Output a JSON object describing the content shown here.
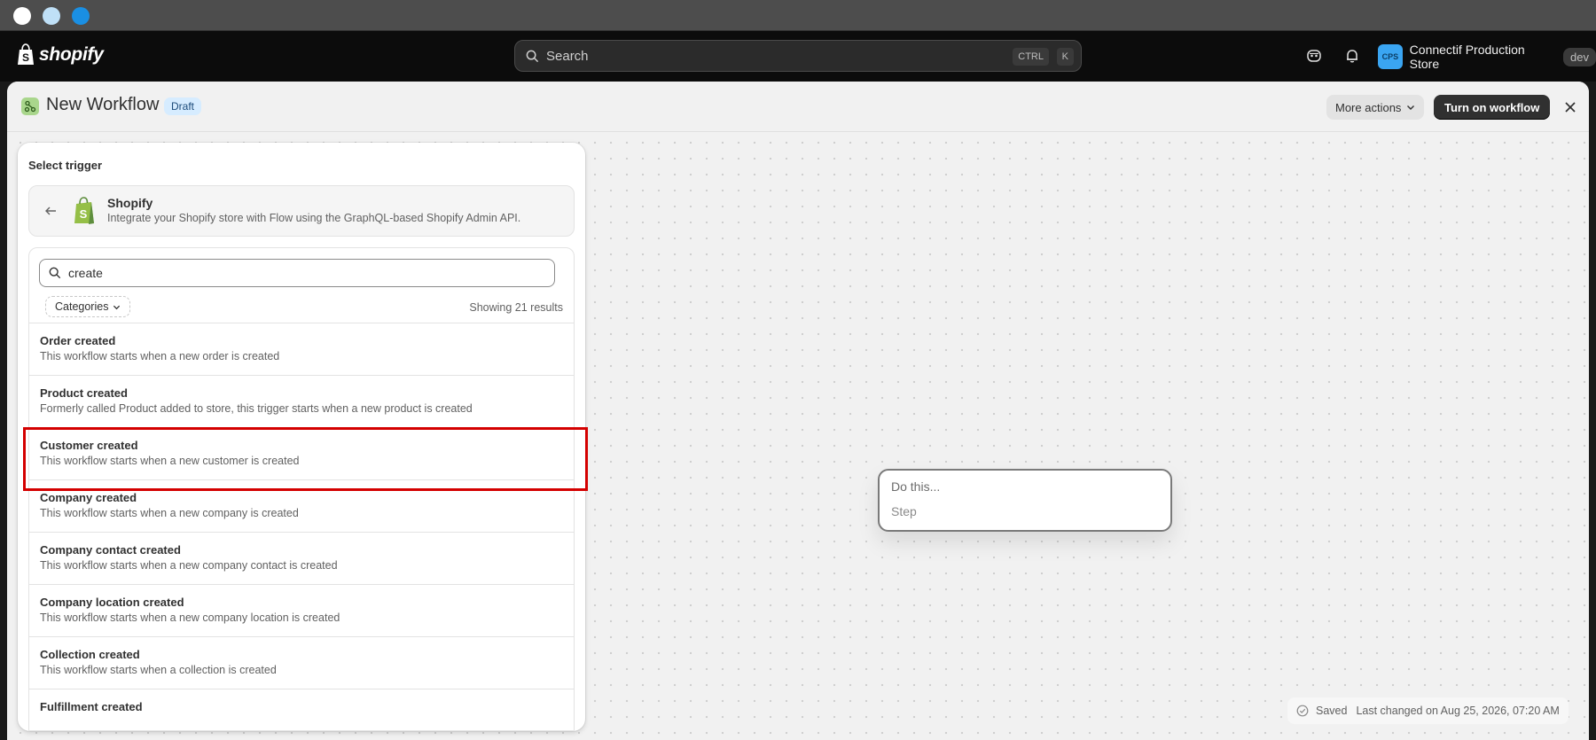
{
  "window": {
    "dots": [
      "close",
      "minimize",
      "maximize"
    ]
  },
  "topbar": {
    "brand": "shopify",
    "search_label": "Search",
    "shortcut_ctrl": "CTRL",
    "shortcut_k": "K",
    "store_avatar": "CPS",
    "store_name": "Connectif Production Store",
    "store_badge": "dev"
  },
  "header": {
    "title": "New Workflow",
    "status_badge": "Draft",
    "more_actions_label": "More actions",
    "turn_on_label": "Turn on workflow"
  },
  "trigger_panel": {
    "title": "Select trigger",
    "app_name": "Shopify",
    "app_description": "Integrate your Shopify store with Flow using the GraphQL-based Shopify Admin API.",
    "search_value": "create",
    "categories_label": "Categories",
    "results_text": "Showing 21 results",
    "selected_index": 2,
    "items": [
      {
        "title": "Order created",
        "description": "This workflow starts when a new order is created"
      },
      {
        "title": "Product created",
        "description": "Formerly called Product added to store, this trigger starts when a new product is created"
      },
      {
        "title": "Customer created",
        "description": "This workflow starts when a new customer is created"
      },
      {
        "title": "Company created",
        "description": "This workflow starts when a new company is created"
      },
      {
        "title": "Company contact created",
        "description": "This workflow starts when a new company contact is created"
      },
      {
        "title": "Company location created",
        "description": "This workflow starts when a new company location is created"
      },
      {
        "title": "Collection created",
        "description": "This workflow starts when a collection is created"
      },
      {
        "title": "Fulfillment created",
        "description": ""
      }
    ]
  },
  "canvas": {
    "node_heading": "Do this...",
    "node_step": "Step"
  },
  "footer": {
    "saved_label": "Saved",
    "last_changed": "Last changed on Aug 25, 2026, 07:20 AM"
  },
  "colors": {
    "topbar_bg": "#0c0c0c",
    "primary_button": "#303030",
    "draft_badge_bg": "#d6ecff",
    "avatar_bg": "#3aa5f2",
    "highlight_border": "#d40000",
    "shopify_green": "#95bf47"
  },
  "icons": {
    "search": "search-icon",
    "ai": "sidekick-icon",
    "bell": "bell-icon",
    "close": "close-icon",
    "back": "arrow-left-icon",
    "chevron": "chevron-down-icon",
    "check": "check-circle-icon",
    "workflow": "flow-icon"
  }
}
